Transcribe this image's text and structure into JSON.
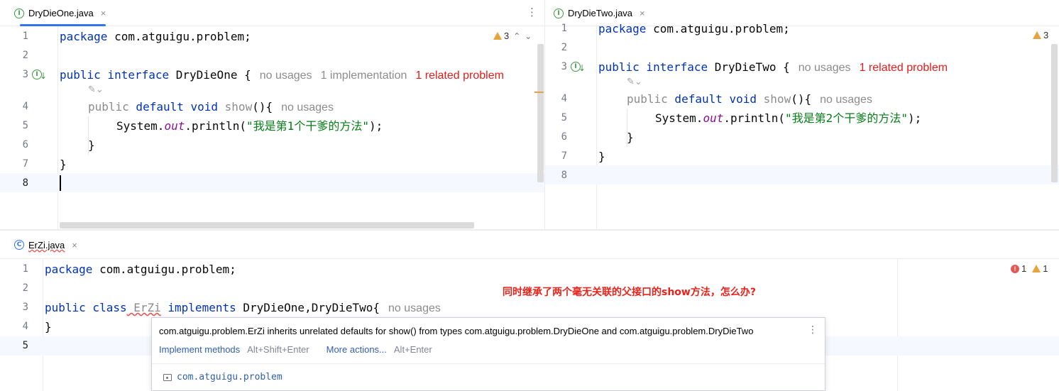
{
  "panes": {
    "left": {
      "tab": {
        "label": "DryDieOne.java",
        "icon": "interface-icon",
        "close": "×"
      },
      "inspections": {
        "warnings": "3",
        "up": "⌃",
        "down": "⌄"
      },
      "lines": [
        "1",
        "2",
        "3",
        "4",
        "5",
        "6",
        "7",
        "8"
      ],
      "code": {
        "l1_kw": "package",
        "l1_rest": " com.atguigu.problem;",
        "l3_kw1": "public",
        "l3_kw2": " interface",
        "l3_rest": " DryDieOne {",
        "l3_hint1": "no usages",
        "l3_hint2": "1 implementation",
        "l3_hint3": "1 related problem",
        "l4_pub": "public",
        "l4_kw": " default void",
        "l4_name": " show",
        "l4_rest": "(){",
        "l4_hint": "no usages",
        "l5_a": "System.",
        "l5_out": "out",
        "l5_b": ".println(",
        "l5_str": "\"我是第1个干爹的方法\"",
        "l5_c": ");",
        "l6": "}",
        "l7": "}"
      }
    },
    "right": {
      "tab": {
        "label": "DryDieTwo.java",
        "icon": "interface-icon",
        "close": "×"
      },
      "inspections": {
        "warnings": "3"
      },
      "lines": [
        "1",
        "2",
        "3",
        "4",
        "5",
        "6",
        "7",
        "8"
      ],
      "code": {
        "l1_kw": "package",
        "l1_rest": " com.atguigu.problem;",
        "l3_kw1": "public",
        "l3_kw2": " interface",
        "l3_rest": " DryDieTwo {",
        "l3_hint1": "no usages",
        "l3_hint2": "1 related problem",
        "l4_pub": "public",
        "l4_kw": " default void",
        "l4_name": " show",
        "l4_rest": "(){",
        "l4_hint": "no usages",
        "l5_a": "System.",
        "l5_out": "out",
        "l5_b": ".println(",
        "l5_str": "\"我是第2个干爹的方法\"",
        "l5_c": ");",
        "l6": "}",
        "l7": "}"
      }
    },
    "bottom": {
      "tab": {
        "label": "ErZi.java",
        "icon": "class-icon",
        "close": "×"
      },
      "inspections": {
        "errors": "1",
        "warnings": "1"
      },
      "lines": [
        "1",
        "2",
        "3",
        "4",
        "5"
      ],
      "code": {
        "l1_kw": "package",
        "l1_rest": " com.atguigu.problem;",
        "l3_kw1": "public",
        "l3_kw2": " class",
        "l3_name": " ErZi",
        "l3_kw3": " implements",
        "l3_rest": " DryDieOne,DryDieTwo{",
        "l3_hint": "no usages",
        "l4": "}"
      }
    }
  },
  "annotation": "同时继承了两个毫无关联的父接口的show方法，怎么办?",
  "popup": {
    "message": "com.atguigu.problem.ErZi inherits unrelated defaults for show() from types com.atguigu.problem.DryDieOne and com.atguigu.problem.DryDieTwo",
    "action1": "Implement methods",
    "shortcut1": "Alt+Shift+Enter",
    "action2": "More actions...",
    "shortcut2": "Alt+Enter",
    "package": "com.atguigu.problem",
    "menu": "⋮"
  },
  "kebab": "⋮",
  "gutter_icon_letter": "I",
  "class_icon_letter": "C",
  "colors": {
    "keyword": "#0033b3",
    "string": "#067d17",
    "field": "#871094",
    "error": "#e51b1b",
    "accent": "#3574f0"
  }
}
